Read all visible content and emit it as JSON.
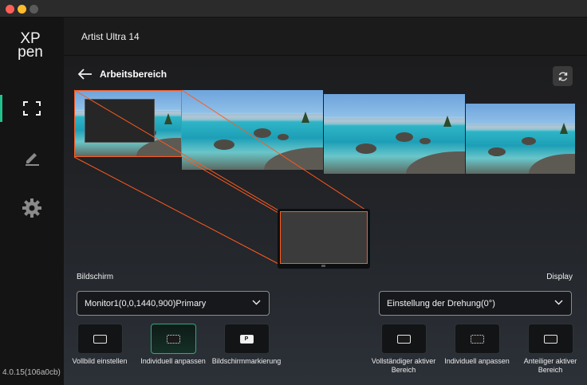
{
  "app": {
    "version": "4.0.15(106a0cb)",
    "device_name": "Artist Ultra 14"
  },
  "sidebar": {
    "items": [
      {
        "name": "work-area",
        "icon": "work-area-icon",
        "active": true
      },
      {
        "name": "pen",
        "icon": "pen-icon",
        "active": false
      },
      {
        "name": "settings",
        "icon": "gear-icon",
        "active": false
      }
    ]
  },
  "page": {
    "title": "Arbeitsbereich"
  },
  "screen": {
    "label": "Bildschirm",
    "selected": "Monitor1(0,0,1440,900)Primary",
    "options": [
      {
        "label": "Vollbild einstellen",
        "icon": "full-screen-icon",
        "selected": false
      },
      {
        "label": "Individuell anpassen",
        "icon": "custom-area-icon",
        "selected": true
      },
      {
        "label": "Bildschirmmarkierung",
        "icon": "screen-mark-icon",
        "glyph": "P",
        "selected": false
      }
    ]
  },
  "display": {
    "label": "Display",
    "rotation": "Einstellung der Drehung(0°)",
    "options": [
      {
        "label": "Vollständiger aktiver Bereich",
        "icon": "full-active-area-icon"
      },
      {
        "label": "Individuell anpassen",
        "icon": "custom-area-icon"
      },
      {
        "label": "Anteiliger aktiver Bereich",
        "icon": "proportional-area-icon"
      }
    ]
  },
  "colors": {
    "accent": "#22c28e",
    "highlight": "#ff5a1f"
  }
}
